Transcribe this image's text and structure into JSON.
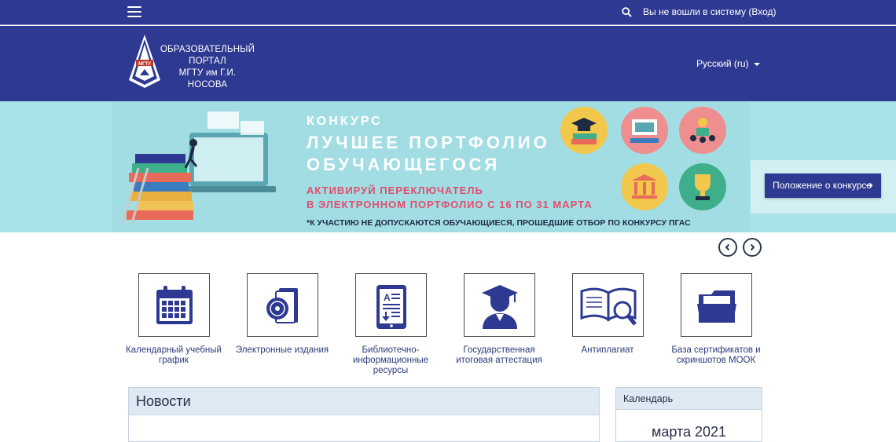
{
  "topbar": {
    "menu_icon": "hamburger-menu-icon",
    "search_icon": "search-icon",
    "login_text": "Вы не вошли в систему (Вход)"
  },
  "header": {
    "logo_icon": "mgtu-logo",
    "logo_lines": [
      "ОБРАЗОВАТЕЛЬНЫЙ",
      "ПОРТАЛ",
      "МГТУ им Г.И. НОСОВА"
    ],
    "language": "Русский (ru)"
  },
  "banner": {
    "konkurs": "КОНКУРС",
    "title_line1": "ЛУЧШЕЕ ПОРТФОЛИО",
    "title_line2": "ОБУЧАЮЩЕГОСЯ",
    "subtitle_line1": "АКТИВИРУЙ ПЕРЕКЛЮЧАТЕЛЬ",
    "subtitle_line2": "В ЭЛЕКТРОННОМ ПОРТФОЛИО С 16 ПО 31 МАРТА",
    "note": "*К УЧАСТИЮ НЕ ДОПУСКАЮТСЯ ОБУЧАЮЩИЕСЯ, ПРОШЕДШИЕ ОТБОР ПО КОНКУРСУ ПГАС",
    "button_label": "Положение о конкурсе",
    "colors": {
      "background": "#a2dde3",
      "accent": "#e14d6c",
      "button": "#2e3991"
    }
  },
  "carousel": {
    "prev_icon": "chevron-left-icon",
    "next_icon": "chevron-right-icon"
  },
  "tiles": [
    {
      "label_lines": [
        "Календарный учебный",
        "график"
      ],
      "icon": "calendar-icon"
    },
    {
      "label_lines": [
        "Электронные издания"
      ],
      "icon": "disc-book-icon"
    },
    {
      "label_lines": [
        "Библиотечно-",
        "информационные",
        "ресурсы"
      ],
      "icon": "ebook-reader-icon"
    },
    {
      "label_lines": [
        "Государственная",
        "итоговая аттестация"
      ],
      "icon": "graduate-icon"
    },
    {
      "label_lines": [
        "Антиплагиат"
      ],
      "icon": "book-magnifier-icon"
    },
    {
      "label_lines": [
        "База сертификатов и",
        "скриншотов МООК"
      ],
      "icon": "folder-icon"
    }
  ],
  "news": {
    "title": "Новости"
  },
  "calendar": {
    "title": "Календарь",
    "month": "марта 2021"
  },
  "theme": {
    "primary": "#2e3991",
    "block_header": "#dfe9f3",
    "tile_text": "#2d3b7a"
  }
}
